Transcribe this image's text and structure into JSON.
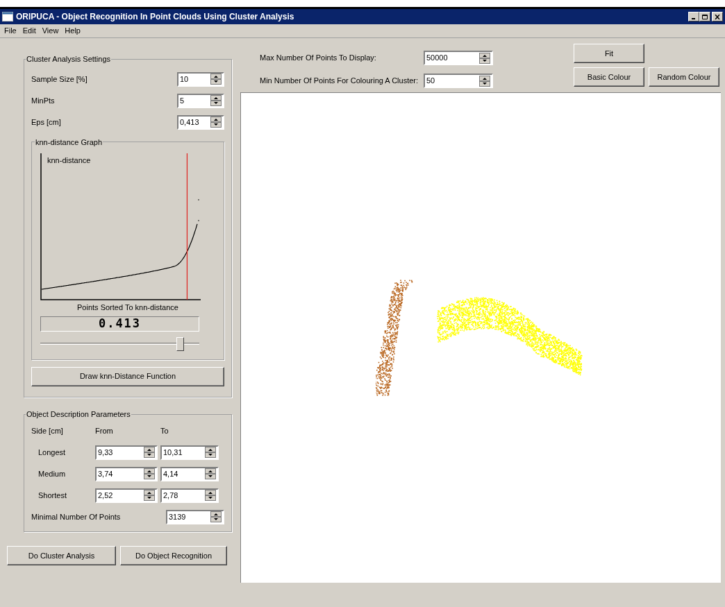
{
  "window": {
    "title": "ORIPUCA - Object Recognition In Point Clouds Using Cluster Analysis"
  },
  "menu": [
    "File",
    "Edit",
    "View",
    "Help"
  ],
  "cluster_settings": {
    "title": "Cluster Analysis Settings",
    "fields": [
      {
        "label": "Sample Size [%]",
        "value": "10"
      },
      {
        "label": "MinPts",
        "value": "5"
      },
      {
        "label": "Eps [cm]",
        "value": "0,413"
      }
    ],
    "knn_graph": {
      "title": "knn-distance Graph",
      "ylabel": "knn-distance",
      "xlabel": "Points Sorted To knn-distance",
      "display": "0.413",
      "slider": {
        "level": 0.88
      }
    },
    "button": "Draw knn-Distance Function"
  },
  "object_params": {
    "title": "Object Description Parameters",
    "header": [
      "Side [cm]",
      "From",
      "To"
    ],
    "rows": [
      {
        "label": "Longest",
        "from": "9,33",
        "to": "10,31"
      },
      {
        "label": "Medium",
        "from": "3,74",
        "to": "4,14"
      },
      {
        "label": "Shortest",
        "from": "2,52",
        "to": "2,78"
      }
    ],
    "min_points": {
      "label": "Minimal Number Of Points",
      "value": "3139"
    }
  },
  "actions": [
    "Do Cluster Analysis",
    "Do Object Recognition"
  ],
  "display_settings": [
    {
      "label": "Max Number Of Points To Display:",
      "value": "50000"
    },
    {
      "label": "Min Number Of Points For Colouring A Cluster:",
      "value": "50"
    }
  ],
  "view_buttons": [
    "Fit",
    "Basic Colour",
    "Random Colour"
  ],
  "clusters": [
    {
      "color": "#b8651e"
    },
    {
      "color": "#ffff00"
    }
  ]
}
